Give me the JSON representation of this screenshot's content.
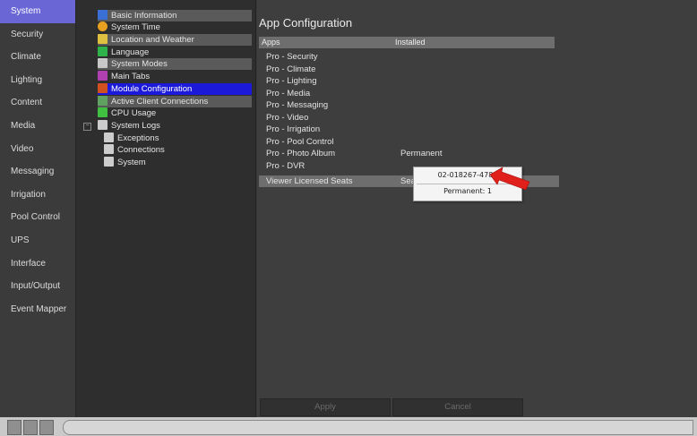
{
  "left_nav": {
    "items": [
      "System",
      "Security",
      "Climate",
      "Lighting",
      "Content",
      "Media",
      "Video",
      "Messaging",
      "Irrigation",
      "Pool Control",
      "UPS",
      "Interface",
      "Input/Output",
      "Event Mapper"
    ],
    "active_index": 0
  },
  "tree": {
    "items": [
      {
        "label": "Basic Information",
        "icon": "info-icon",
        "color": "#3a6fd6"
      },
      {
        "label": "System Time",
        "icon": "clock-icon",
        "color": "#e8a020"
      },
      {
        "label": "Location and Weather",
        "icon": "weather-icon",
        "color": "#e0c040"
      },
      {
        "label": "Language",
        "icon": "globe-icon",
        "color": "#2fb24a"
      },
      {
        "label": "System Modes",
        "icon": "modes-icon",
        "color": "#c8c8c8"
      },
      {
        "label": "Main Tabs",
        "icon": "tabs-icon",
        "color": "#b040b0"
      },
      {
        "label": "Module Configuration",
        "icon": "module-icon",
        "color": "#d05020"
      },
      {
        "label": "Active Client Connections",
        "icon": "connections-icon",
        "color": "#60a060"
      },
      {
        "label": "CPU Usage",
        "icon": "cpu-icon",
        "color": "#40c040"
      },
      {
        "label": "System Logs",
        "icon": "log-icon",
        "color": "#cccccc"
      },
      {
        "label": "Exceptions",
        "icon": "log-icon",
        "color": "#cccccc"
      },
      {
        "label": "Connections",
        "icon": "log-icon",
        "color": "#cccccc"
      },
      {
        "label": "System",
        "icon": "log-icon",
        "color": "#cccccc"
      }
    ],
    "selected_index": 6,
    "expander_symbol": "−"
  },
  "main": {
    "title": "App Configuration",
    "columns": [
      "Apps",
      "Installed"
    ],
    "apps": [
      {
        "name": "Pro - Security",
        "status": ""
      },
      {
        "name": "Pro - Climate",
        "status": ""
      },
      {
        "name": "Pro - Lighting",
        "status": ""
      },
      {
        "name": "Pro - Media",
        "status": ""
      },
      {
        "name": "Pro - Messaging",
        "status": ""
      },
      {
        "name": "Pro - Video",
        "status": ""
      },
      {
        "name": "Pro - Irrigation",
        "status": ""
      },
      {
        "name": "Pro - Pool Control",
        "status": ""
      },
      {
        "name": "Pro - Photo Album",
        "status": "Permanent"
      },
      {
        "name": "Pro - DVR",
        "status": ""
      }
    ],
    "seats": {
      "name": "Viewer Licensed Seats",
      "status": "Sea"
    },
    "popup": {
      "line1": "02-018267-4781",
      "line2": "Permanent: 1"
    },
    "buttons": {
      "apply": "Apply",
      "cancel": "Cancel"
    }
  },
  "colors": {
    "accent": "#6b66d6",
    "selected": "#1c1ad8",
    "arrow": "#e0201a"
  }
}
